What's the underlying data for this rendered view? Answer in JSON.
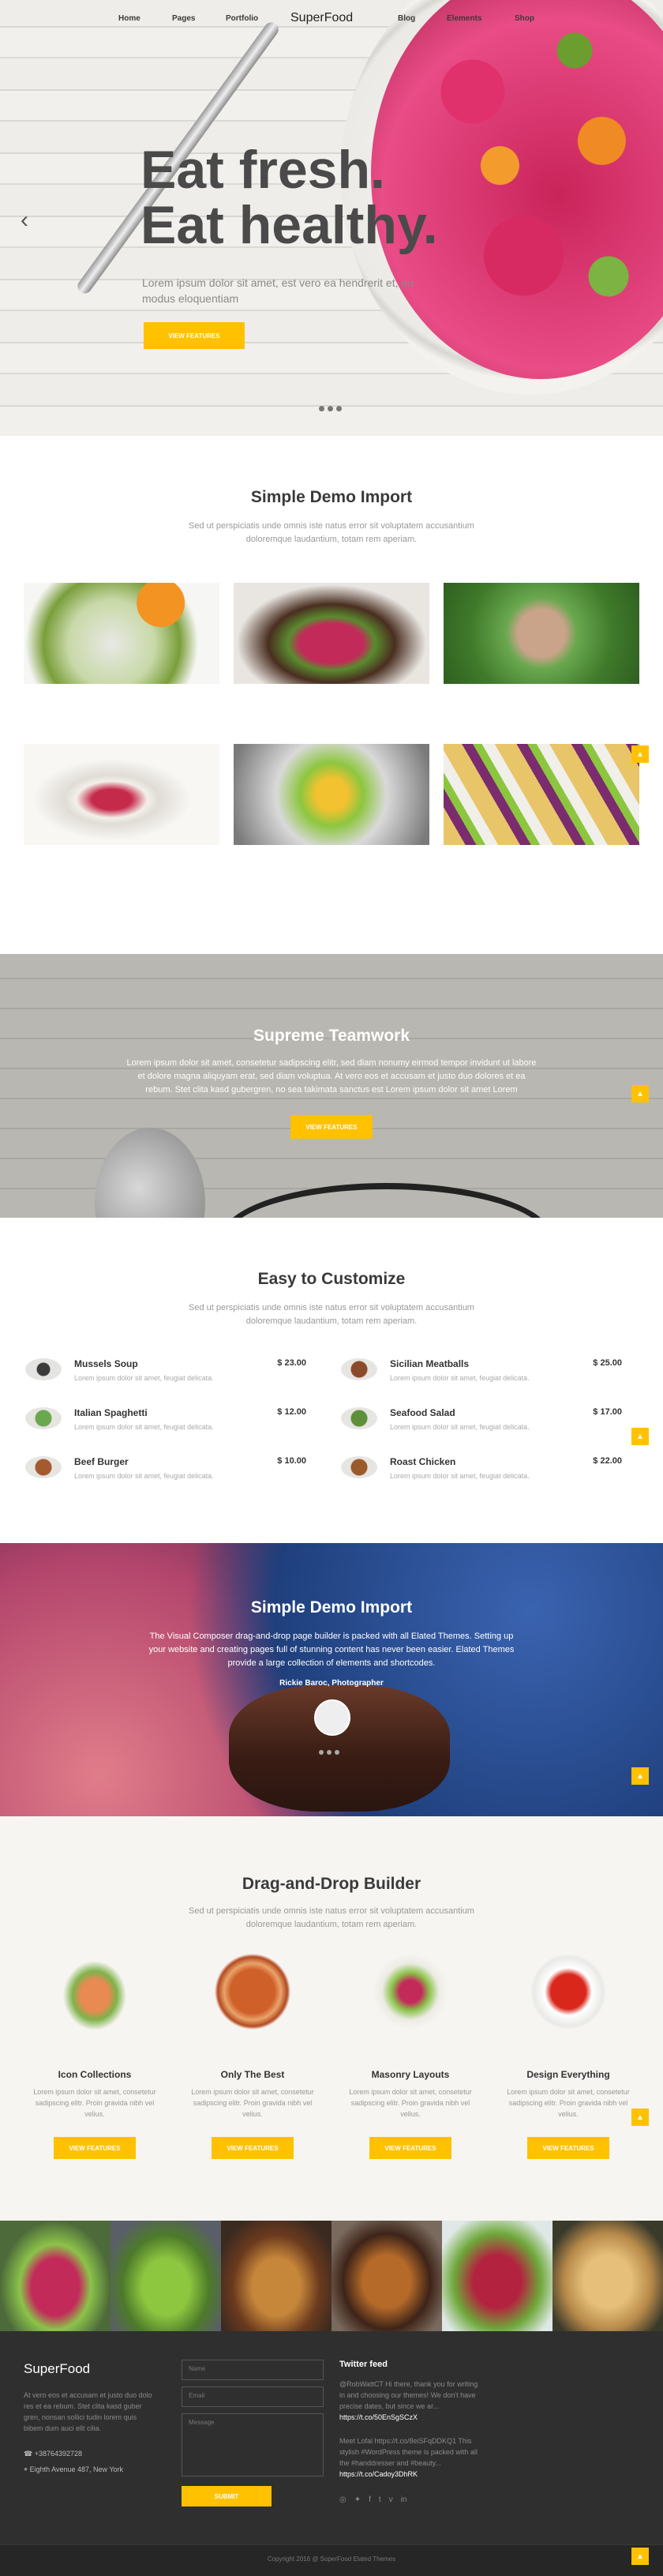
{
  "nav": {
    "items": [
      "Home",
      "Pages",
      "Portfolio",
      "Blog",
      "Elements",
      "Shop"
    ],
    "logo": "SuperFood"
  },
  "hero": {
    "title_line1": "Eat fresh.",
    "title_line2": "Eat healthy.",
    "text": "Lorem ipsum dolor sit amet, est vero ea hendrerit et, eu modus eloquentiam",
    "button": "VIEW FEATURES",
    "prev_arrow": "‹"
  },
  "demo_import": {
    "title": "Simple Demo Import",
    "subtitle": "Sed ut perspiciatis unde omnis iste natus error sit voluptatem accusantium doloremque laudantium, totam rem aperiam."
  },
  "team": {
    "title": "Supreme Teamwork",
    "text": "Lorem ipsum dolor sit amet, consetetur sadipscing elitr, sed diam nonumy eirmod tempor invidunt ut labore et dolore magna aliquyam erat, sed diam voluptua. At vero eos et accusam et justo duo dolores et ea rebum. Stet clita kasd gubergren, no sea takimata sanctus est Lorem ipsum dolor sit amet Lorem",
    "button": "VIEW FEATURES"
  },
  "customize": {
    "title": "Easy to Customize",
    "subtitle": "Sed ut perspiciatis unde omnis iste natus error sit voluptatem accusantium doloremque laudantium, totam rem aperiam.",
    "items": [
      {
        "name": "Mussels Soup",
        "price": "$ 23.00",
        "desc": "Lorem ipsum dolor sit amet, feugiat delicata."
      },
      {
        "name": "Sicilian Meatballs",
        "price": "$ 25.00",
        "desc": "Lorem ipsum dolor sit amet, feugiat delicata."
      },
      {
        "name": "Italian Spaghetti",
        "price": "$ 12.00",
        "desc": "Lorem ipsum dolor sit amet, feugiat delicata."
      },
      {
        "name": "Seafood Salad",
        "price": "$ 17.00",
        "desc": "Lorem ipsum dolor sit amet, feugiat delicata."
      },
      {
        "name": "Beef Burger",
        "price": "$ 10.00",
        "desc": "Lorem ipsum dolor sit amet, feugiat delicata."
      },
      {
        "name": "Roast Chicken",
        "price": "$ 22.00",
        "desc": "Lorem ipsum dolor sit amet, feugiat delicata."
      }
    ]
  },
  "testimonial": {
    "title": "Simple Demo Import",
    "text": "The Visual Composer drag-and-drop page builder is packed with all Elated Themes. Setting up your website and creating pages full of stunning content has never been easier. Elated Themes provide a large collection of elements and shortcodes.",
    "author": "Rickie Baroc, Photographer"
  },
  "builder": {
    "title": "Drag-and-Drop Builder",
    "subtitle": "Sed ut perspiciatis unde omnis iste natus error sit voluptatem accusantium doloremque laudantium, totam rem aperiam.",
    "features": [
      {
        "title": "Icon Collections",
        "desc": "Lorem ipsum dolor sit amet, consetetur sadipscing elitr. Proin gravida nibh vel velius.",
        "button": "VIEW FEATURES"
      },
      {
        "title": "Only The Best",
        "desc": "Lorem ipsum dolor sit amet, consetetur sadipscing elitr. Proin gravida nibh vel velius.",
        "button": "VIEW FEATURES"
      },
      {
        "title": "Masonry Layouts",
        "desc": "Lorem ipsum dolor sit amet, consetetur sadipscing elitr. Proin gravida nibh vel velius.",
        "button": "VIEW FEATURES"
      },
      {
        "title": "Design Everything",
        "desc": "Lorem ipsum dolor sit amet, consetetur sadipscing elitr. Proin gravida nibh vel velius.",
        "button": "VIEW FEATURES"
      }
    ]
  },
  "footer": {
    "logo": "SuperFood",
    "about": "At vero eos et accusam et justo duo dolo res et ea rebum. Stet clita kasd guber gren, nonsan sollici tudin lorem quis bibem dum auci elit cilia.",
    "phone": "+38764392728",
    "address": "Eighth Avenue 487, New York",
    "name_placeholder": "Name",
    "email_placeholder": "Email",
    "message_placeholder": "Message",
    "submit": "SUBMIT",
    "twitter_title": "Twitter feed",
    "tweet1": "@RobWattCT Hi there, thank you for writing in and choosing our themes! We don't have precise dates, but since we ar...",
    "tweet1_link": "https://t.co/50EnSgSCzX",
    "tweet2": "Meet Lofal https://t.co/8eiSFqDDKQ1 This stylish #WordPress theme is packed with all the #handdresser and #beauty...",
    "tweet2_link": "https://t.co/Cadoy3DhRK",
    "copyright": "Copyright 2016 @ SuperFood Elated Themes"
  },
  "colors": {
    "accent": "#ffc100",
    "footer_bg": "#2f2f2f"
  }
}
